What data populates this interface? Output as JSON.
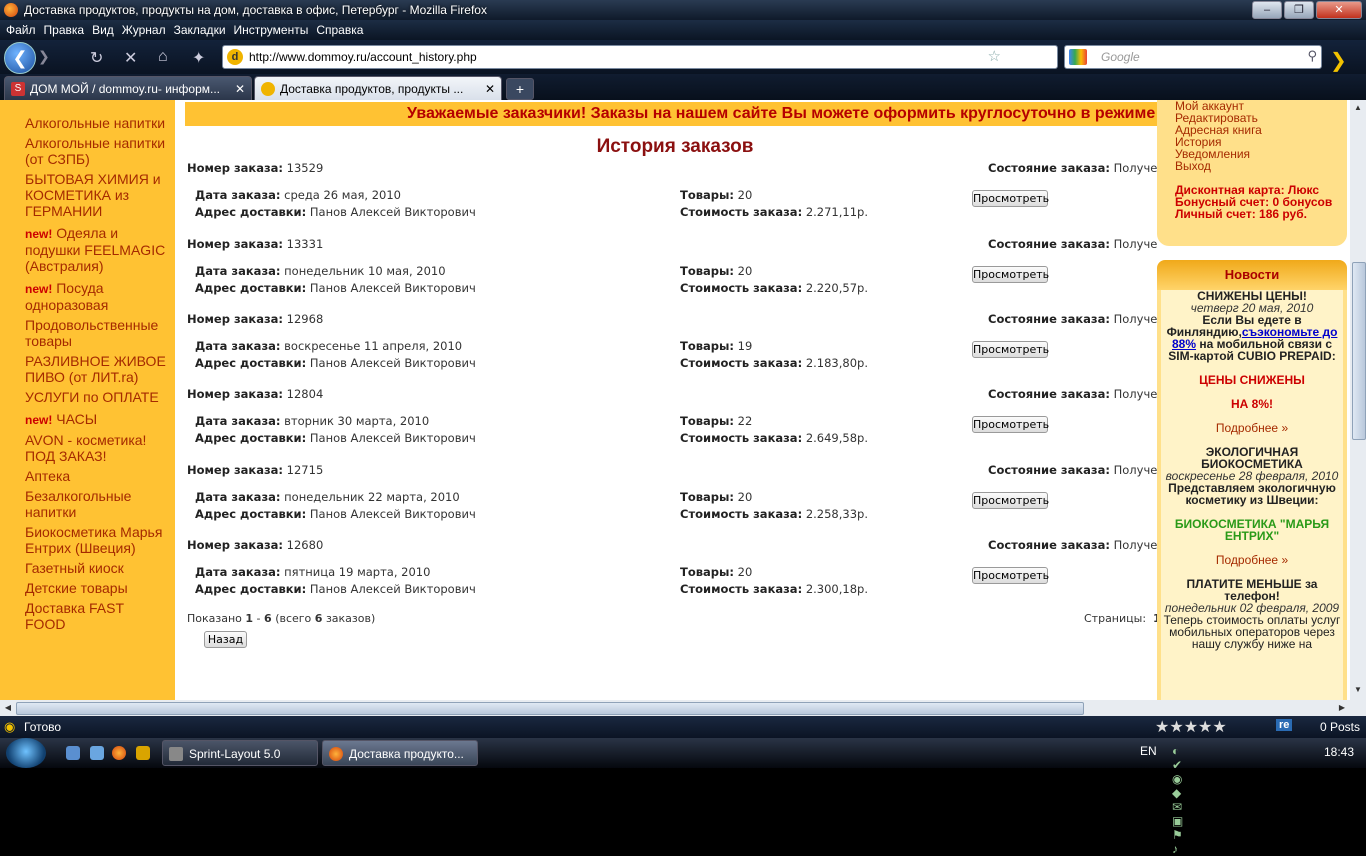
{
  "window": {
    "title": "Доставка продуктов, продукты на дом, доставка в офис, Петербург - Mozilla Firefox",
    "min": "‒",
    "max": "❐",
    "close": "✕"
  },
  "menu": [
    "Файл",
    "Правка",
    "Вид",
    "Журнал",
    "Закладки",
    "Инструменты",
    "Справка"
  ],
  "nav": {
    "url": "http://www.dommoy.ru/account_history.php",
    "search_placeholder": "Google"
  },
  "tabs": [
    {
      "label": "ДОМ МОЙ / dommoy.ru- информ...",
      "active": false
    },
    {
      "label": "Доставка продуктов, продукты ...",
      "active": true
    }
  ],
  "sidebar": {
    "categories": [
      {
        "label": "Алкогольные напитки",
        "new": false
      },
      {
        "label": "Алкогольные напитки (от СЗПБ)",
        "new": false
      },
      {
        "label": "БЫТОВАЯ ХИМИЯ и КОСМЕТИКА из ГЕРМАНИИ",
        "new": false
      },
      {
        "label": "Одеяла и подушки FEELMAGIC (Австралия)",
        "new": true
      },
      {
        "label": "Посуда одноразовая",
        "new": true
      },
      {
        "label": "Продовольственные товары",
        "new": false
      },
      {
        "label": "РАЗЛИВНОЕ ЖИВОЕ ПИВО (от ЛИТ.ra)",
        "new": false
      },
      {
        "label": "УСЛУГИ по ОПЛАТЕ",
        "new": false
      },
      {
        "label": "ЧАСЫ",
        "new": true
      },
      {
        "label": "AVON - косметика! ПОД ЗАКАЗ!",
        "new": false
      },
      {
        "label": "Аптека",
        "new": false
      },
      {
        "label": "Безалкогольные напитки",
        "new": false
      },
      {
        "label": "Биокосметика Марья Ентрих (Швеция)",
        "new": false
      },
      {
        "label": "Газетный киоск",
        "new": false
      },
      {
        "label": "Детские товары",
        "new": false
      },
      {
        "label": "Доставка FAST FOOD",
        "new": false
      }
    ],
    "new_label": "new!"
  },
  "main": {
    "banner": "Уважаемые заказчики! Заказы на нашем сайте Вы можете оформить круглосуточно в режиме",
    "heading": "История заказов",
    "labels": {
      "order_no": "Номер заказа:",
      "status": "Состояние заказа:",
      "date": "Дата заказа:",
      "address": "Адрес доставки:",
      "items": "Товары:",
      "cost": "Стоимость заказа:",
      "view": "Просмотреть"
    },
    "orders": [
      {
        "no": "13529",
        "status": "Получен",
        "date": "среда 26 мая, 2010",
        "address": "Панов Алексей Викторович",
        "items": "20",
        "cost": "2.271,11р."
      },
      {
        "no": "13331",
        "status": "Получен",
        "date": "понедельник 10 мая, 2010",
        "address": "Панов Алексей Викторович",
        "items": "20",
        "cost": "2.220,57р."
      },
      {
        "no": "12968",
        "status": "Получен",
        "date": "воскресенье 11 апреля, 2010",
        "address": "Панов Алексей Викторович",
        "items": "19",
        "cost": "2.183,80р."
      },
      {
        "no": "12804",
        "status": "Получен",
        "date": "вторник 30 марта, 2010",
        "address": "Панов Алексей Викторович",
        "items": "22",
        "cost": "2.649,58р."
      },
      {
        "no": "12715",
        "status": "Получен",
        "date": "понедельник 22 марта, 2010",
        "address": "Панов Алексей Викторович",
        "items": "20",
        "cost": "2.258,33р."
      },
      {
        "no": "12680",
        "status": "Получен",
        "date": "пятница 19 марта, 2010",
        "address": "Панов Алексей Викторович",
        "items": "20",
        "cost": "2.300,18р."
      }
    ],
    "footer": {
      "shown_prefix": "Показано",
      "from": "1",
      "dash": " - ",
      "to": "6",
      "total_prefix": "(всего",
      "total": "6",
      "total_suffix": "заказов)",
      "pages_label": "Страницы:",
      "page": "1",
      "back": "Назад"
    }
  },
  "account": {
    "links": [
      "Мой аккаунт",
      "Редактировать",
      "Адресная книга",
      "История",
      "Уведомления",
      "Выход"
    ],
    "discount": "Дисконтная карта: Люкс",
    "bonus": "Бонусный счет: 0 бонусов",
    "personal": "Личный счет: 186 руб."
  },
  "news": {
    "title": "Новости",
    "items": {
      "n1_title": "СНИЖЕНЫ ЦЕНЫ!",
      "n1_date": "четверг 20 мая, 2010",
      "n1_text_a": "Если Вы едете в Финляндию,",
      "n1_link": "съэкономьте до 88%",
      "n1_text_b": " на мобильной связи с SIM-картой CUBIO PREPAID:",
      "n1_red1": "ЦЕНЫ СНИЖЕНЫ",
      "n1_red2": "НА 8%!",
      "more": "Подробнее »",
      "n2_title": "ЭКОЛОГИЧНАЯ БИОКОСМЕТИКА",
      "n2_date": "воскресенье 28 февраля, 2010",
      "n2_text": "Представляем экологичную косметику из Швеции:",
      "n2_green": "БИОКОСМЕТИКА \"МАРЬЯ ЕНТРИХ\"",
      "n3_title": "ПЛАТИТЕ МЕНЬШЕ за телефон!",
      "n3_date": "понедельник 02 февраля, 2009",
      "n3_text": "Теперь стоимость оплаты услуг мобильных операторов через нашу службу ниже на"
    }
  },
  "status": {
    "text": "Готово",
    "posts": "0 Posts",
    "re": "re"
  },
  "taskbar": {
    "tasks": [
      "Sprint-Layout 5.0",
      "Доставка продукто..."
    ],
    "lang": "EN",
    "clock": "18:43"
  }
}
